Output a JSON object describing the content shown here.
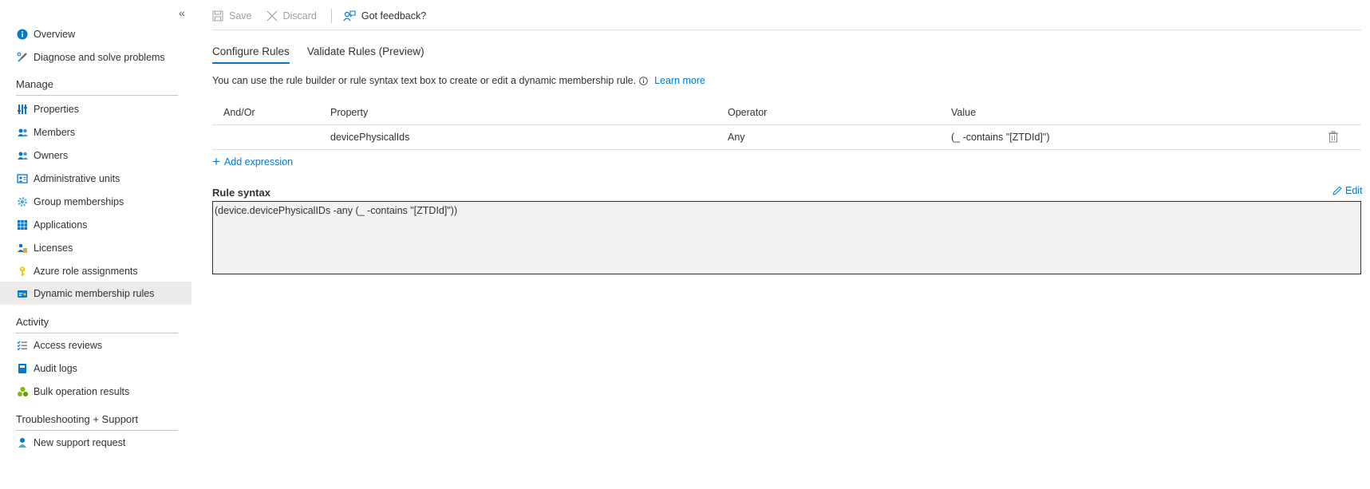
{
  "sidebar": {
    "collapse_glyph": "«",
    "items_top": [
      {
        "label": "Overview",
        "icon": "info-icon"
      },
      {
        "label": "Diagnose and solve problems",
        "icon": "wrench-icon"
      }
    ],
    "sections": [
      {
        "title": "Manage",
        "items": [
          {
            "label": "Properties",
            "icon": "properties-icon"
          },
          {
            "label": "Members",
            "icon": "members-icon"
          },
          {
            "label": "Owners",
            "icon": "owners-icon"
          },
          {
            "label": "Administrative units",
            "icon": "admin-units-icon"
          },
          {
            "label": "Group memberships",
            "icon": "gear-icon"
          },
          {
            "label": "Applications",
            "icon": "apps-grid-icon"
          },
          {
            "label": "Licenses",
            "icon": "licenses-icon"
          },
          {
            "label": "Azure role assignments",
            "icon": "key-icon"
          },
          {
            "label": "Dynamic membership rules",
            "icon": "dynamic-rules-icon",
            "active": true
          }
        ]
      },
      {
        "title": "Activity",
        "items": [
          {
            "label": "Access reviews",
            "icon": "checklist-icon"
          },
          {
            "label": "Audit logs",
            "icon": "book-icon"
          },
          {
            "label": "Bulk operation results",
            "icon": "bulk-icon"
          }
        ]
      },
      {
        "title": "Troubleshooting + Support",
        "items": [
          {
            "label": "New support request",
            "icon": "support-person-icon"
          }
        ]
      }
    ]
  },
  "toolbar": {
    "save_label": "Save",
    "discard_label": "Discard",
    "feedback_label": "Got feedback?"
  },
  "tabs": [
    {
      "label": "Configure Rules",
      "active": true
    },
    {
      "label": "Validate Rules (Preview)",
      "active": false
    }
  ],
  "description": {
    "text": "You can use the rule builder or rule syntax text box to create or edit a dynamic membership rule.",
    "learn_more": "Learn more"
  },
  "grid": {
    "headers": {
      "and_or": "And/Or",
      "property": "Property",
      "operator": "Operator",
      "value": "Value"
    },
    "rows": [
      {
        "and_or": "",
        "property": "devicePhysicalIds",
        "operator": "Any",
        "value": "(_ -contains \"[ZTDId]\")"
      }
    ]
  },
  "add_expression_label": "Add expression",
  "rule_syntax": {
    "label": "Rule syntax",
    "edit_label": "Edit",
    "value": "(device.devicePhysicalIDs -any (_ -contains \"[ZTDId]\"))"
  },
  "colors": {
    "accent": "#0078d4",
    "active_bg": "#edebe9",
    "box_bg": "#f3f2f1"
  }
}
